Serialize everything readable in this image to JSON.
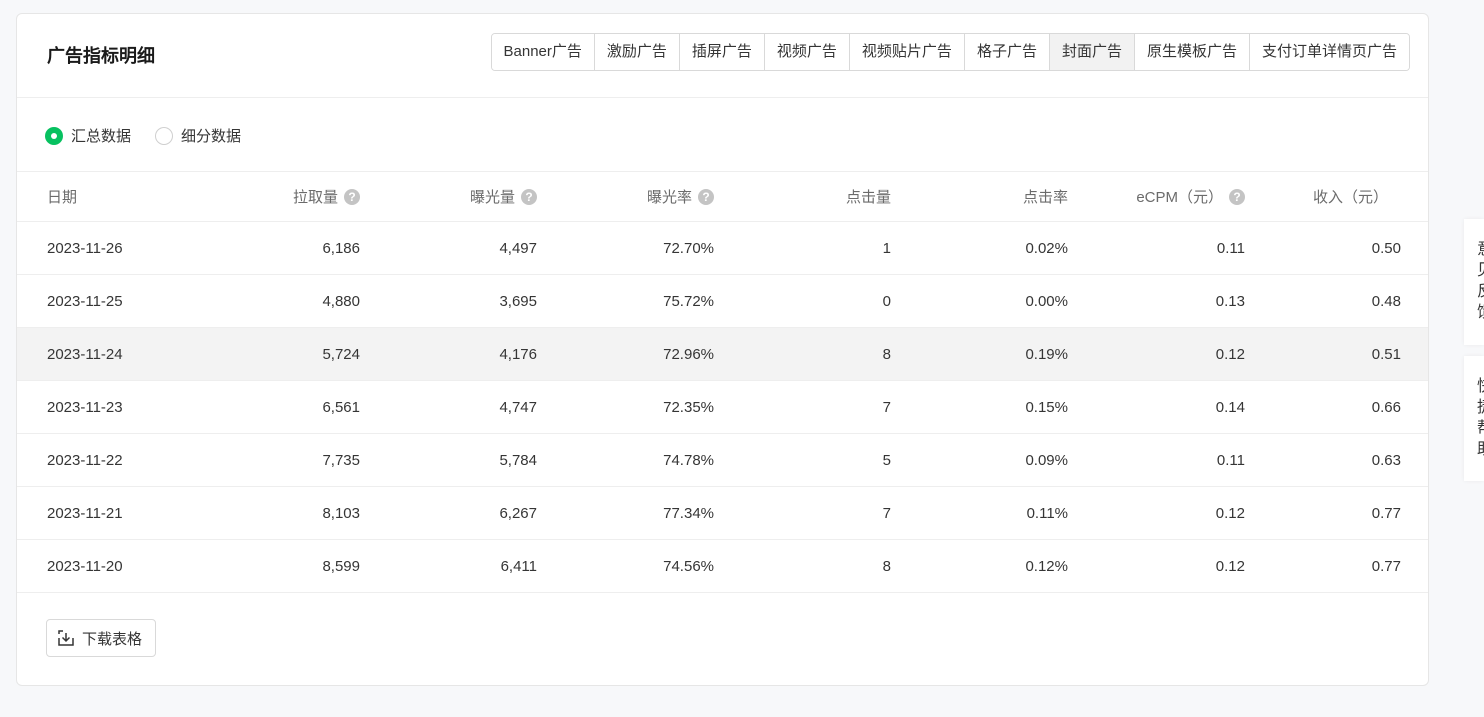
{
  "header": {
    "title": "广告指标明细",
    "tabs": [
      {
        "label": "Banner广告",
        "active": false
      },
      {
        "label": "激励广告",
        "active": false
      },
      {
        "label": "插屏广告",
        "active": false
      },
      {
        "label": "视频广告",
        "active": false
      },
      {
        "label": "视频贴片广告",
        "active": false
      },
      {
        "label": "格子广告",
        "active": false
      },
      {
        "label": "封面广告",
        "active": true
      },
      {
        "label": "原生模板广告",
        "active": false
      },
      {
        "label": "支付订单详情页广告",
        "active": false
      }
    ]
  },
  "filter": {
    "options": [
      {
        "label": "汇总数据",
        "checked": true
      },
      {
        "label": "细分数据",
        "checked": false
      }
    ]
  },
  "table": {
    "columns": [
      {
        "label": "日期",
        "help": false
      },
      {
        "label": "拉取量",
        "help": true
      },
      {
        "label": "曝光量",
        "help": true
      },
      {
        "label": "曝光率",
        "help": true
      },
      {
        "label": "点击量",
        "help": false
      },
      {
        "label": "点击率",
        "help": false
      },
      {
        "label": "eCPM（元）",
        "help": true
      },
      {
        "label": "收入（元）",
        "help": false
      }
    ],
    "help_glyph": "?",
    "rows": [
      [
        "2023-11-26",
        "6,186",
        "4,497",
        "72.70%",
        "1",
        "0.02%",
        "0.11",
        "0.50"
      ],
      [
        "2023-11-25",
        "4,880",
        "3,695",
        "75.72%",
        "0",
        "0.00%",
        "0.13",
        "0.48"
      ],
      [
        "2023-11-24",
        "5,724",
        "4,176",
        "72.96%",
        "8",
        "0.19%",
        "0.12",
        "0.51"
      ],
      [
        "2023-11-23",
        "6,561",
        "4,747",
        "72.35%",
        "7",
        "0.15%",
        "0.14",
        "0.66"
      ],
      [
        "2023-11-22",
        "7,735",
        "5,784",
        "74.78%",
        "5",
        "0.09%",
        "0.11",
        "0.63"
      ],
      [
        "2023-11-21",
        "8,103",
        "6,267",
        "77.34%",
        "7",
        "0.11%",
        "0.12",
        "0.77"
      ],
      [
        "2023-11-20",
        "8,599",
        "6,411",
        "74.56%",
        "8",
        "0.12%",
        "0.12",
        "0.77"
      ]
    ],
    "hovered_row": 2
  },
  "footer": {
    "download_label": "下载表格",
    "download_icon": "download-icon"
  },
  "side_panels": [
    {
      "lines": [
        "意",
        "见",
        "反",
        "馈"
      ]
    },
    {
      "lines": [
        "快",
        "捷",
        "帮",
        "助"
      ]
    }
  ],
  "colors": {
    "accent": "#07c160",
    "page_bg": "#f7f8fa",
    "active_tab_bg": "#f2f2f2",
    "hover_row_bg": "#f3f3f3"
  }
}
